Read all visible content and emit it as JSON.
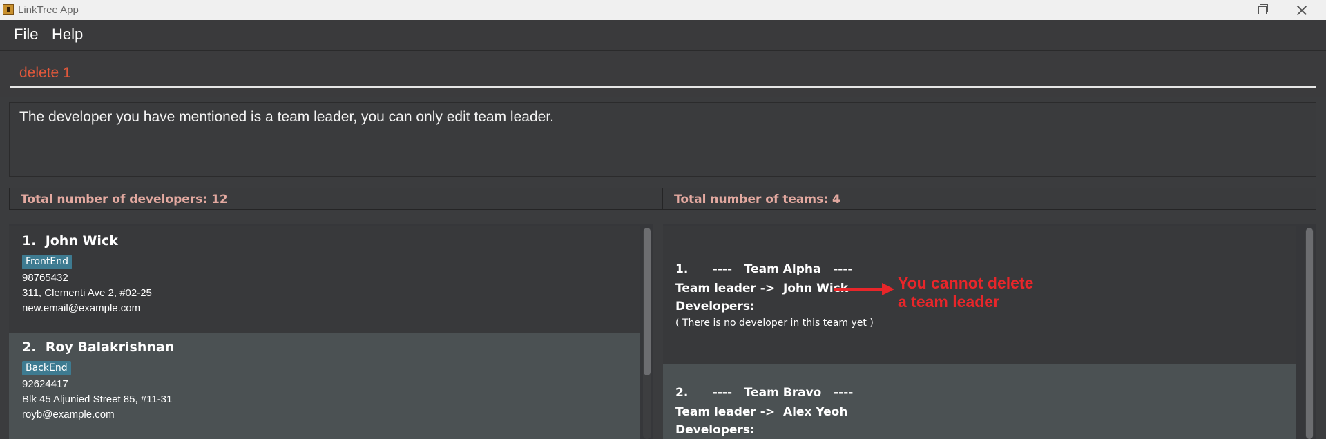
{
  "window": {
    "title": "LinkTree App"
  },
  "menu": {
    "items": [
      "File",
      "Help"
    ]
  },
  "command": {
    "value": "delete 1"
  },
  "result": {
    "message": "The developer you have mentioned is a team leader, you can only edit team leader."
  },
  "developers_panel": {
    "header": "Total number of developers: 12",
    "items": [
      {
        "index": "1.",
        "name": "John Wick",
        "tag": "FrontEnd",
        "phone": "98765432",
        "address": "311, Clementi Ave 2, #02-25",
        "email": "new.email@example.com"
      },
      {
        "index": "2.",
        "name": "Roy Balakrishnan",
        "tag": "BackEnd",
        "phone": "92624417",
        "address": "Blk 45 Aljunied Street 85, #11-31",
        "email": "royb@example.com"
      }
    ]
  },
  "teams_panel": {
    "header": "Total number of teams: 4",
    "items": [
      {
        "index": "1.",
        "name": "Team Alpha",
        "leader_label": "Team leader ->",
        "leader": "John Wick",
        "developers_label": "Developers:",
        "developers_note": "( There is no developer in this team yet )"
      },
      {
        "index": "2.",
        "name": "Team Bravo",
        "leader_label": "Team leader ->",
        "leader": "Alex Yeoh",
        "developers_label": "Developers:"
      }
    ]
  },
  "annotation": {
    "line1": "You cannot delete",
    "line2": "a team leader",
    "color": "#e8262a"
  },
  "colors": {
    "command_text": "#e2583b",
    "header_text": "#e3a9a0",
    "tag_bg": "#3e7b91"
  }
}
